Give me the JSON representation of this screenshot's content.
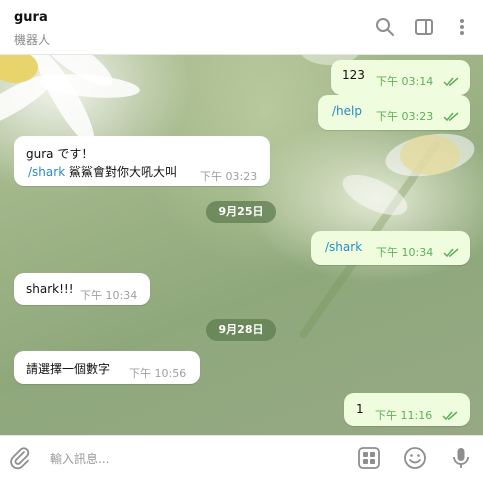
{
  "header": {
    "title": "gura",
    "subtitle": "機器人",
    "icons": [
      "search-icon",
      "sidebar-toggle-icon",
      "more-vertical-icon"
    ]
  },
  "messages": [
    {
      "dir": "out",
      "parts": [
        {
          "text": "123",
          "cmd": false
        }
      ],
      "time": "下午 03:14",
      "read": true
    },
    {
      "dir": "out",
      "parts": [
        {
          "text": "/help",
          "cmd": true
        }
      ],
      "time": "下午 03:23",
      "read": true
    },
    {
      "dir": "in",
      "line1": "gura です！",
      "parts": [
        {
          "text": "/shark",
          "cmd": true
        },
        {
          "text": " 鯊鯊會對你大吼大叫",
          "cmd": false
        }
      ],
      "time": "下午 03:23"
    },
    {
      "dir": "date",
      "text": "9月25日"
    },
    {
      "dir": "out",
      "parts": [
        {
          "text": "/shark",
          "cmd": true
        }
      ],
      "time": "下午 10:34",
      "read": true
    },
    {
      "dir": "in",
      "parts": [
        {
          "text": "shark!!!",
          "cmd": false
        }
      ],
      "time": "下午 10:34"
    },
    {
      "dir": "date",
      "text": "9月28日"
    },
    {
      "dir": "in",
      "parts": [
        {
          "text": "請選擇一個數字",
          "cmd": false
        }
      ],
      "time": "下午 10:56"
    },
    {
      "dir": "out",
      "parts": [
        {
          "text": "1",
          "cmd": false
        }
      ],
      "time": "下午 11:16",
      "read": true
    }
  ],
  "composer": {
    "placeholder": "輸入訊息...",
    "icons": [
      "attach-icon",
      "bot-keyboard-icon",
      "emoji-icon",
      "microphone-icon"
    ]
  },
  "colors": {
    "outgoing_bubble": "#effdde",
    "incoming_bubble": "#ffffff",
    "accent_green": "#5fae5a",
    "link_blue": "#2a8ac7"
  }
}
